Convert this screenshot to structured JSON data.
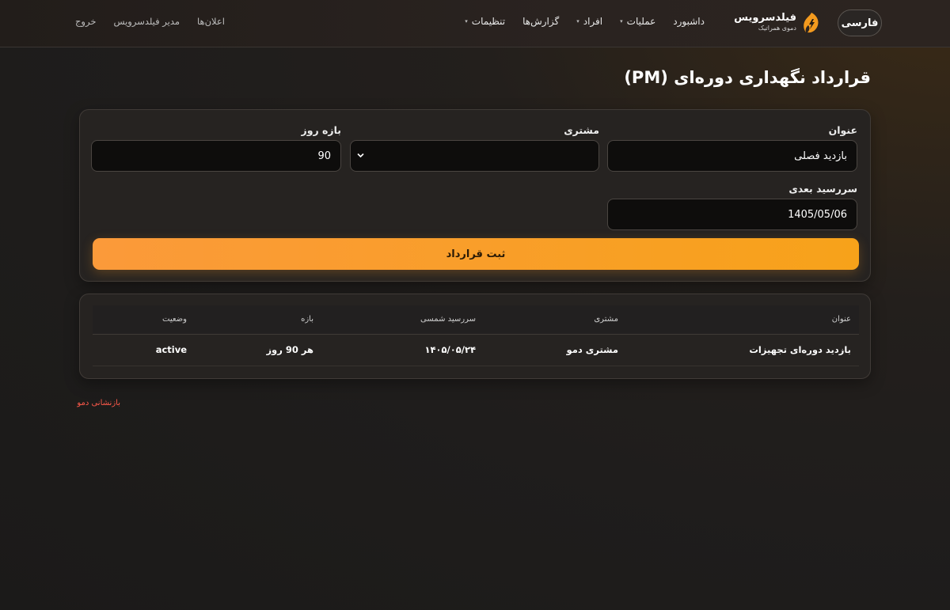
{
  "header": {
    "lang_button": "فارسی",
    "brand_name": "فیلدسرویس",
    "brand_sub": "دموی همراتیک",
    "nav": [
      {
        "label": "داشبورد",
        "has_caret": false
      },
      {
        "label": "عملیات",
        "has_caret": true
      },
      {
        "label": "افراد",
        "has_caret": true
      },
      {
        "label": "گزارش‌ها",
        "has_caret": false
      },
      {
        "label": "تنظیمات",
        "has_caret": true
      }
    ],
    "util": {
      "notifications": "اعلان‌ها",
      "user": "مدیر فیلدسرویس",
      "logout": "خروج"
    }
  },
  "page": {
    "title": "قرارداد نگهداری دوره‌ای (PM)"
  },
  "form": {
    "title_label": "عنوان",
    "title_value": "بازدید فصلی",
    "customer_label": "مشتری",
    "customer_value": "",
    "interval_label": "بازه روز",
    "interval_value": "90",
    "next_due_label": "سررسید بعدی",
    "next_due_value": "1405/05/06",
    "submit_label": "ثبت قرارداد"
  },
  "table": {
    "headers": [
      "عنوان",
      "مشتری",
      "سررسید شمسی",
      "بازه",
      "وضعیت"
    ],
    "rows": [
      [
        "بازدید دوره‌ای تجهیزات",
        "مشتری دمو",
        "۱۴۰۵/۰۵/۲۴",
        "هر 90 روز",
        "active"
      ]
    ]
  },
  "footer": {
    "reset_link": "بازنشانی دمو"
  },
  "colors": {
    "accent": "#f7a21a",
    "accent_alt": "#fb9a3a",
    "danger": "#ff5a4a"
  },
  "icons": {
    "logo": "wrench-bolt-logo-icon",
    "select": "chevron-down-icon",
    "nav_caret": "caret-down-icon"
  }
}
